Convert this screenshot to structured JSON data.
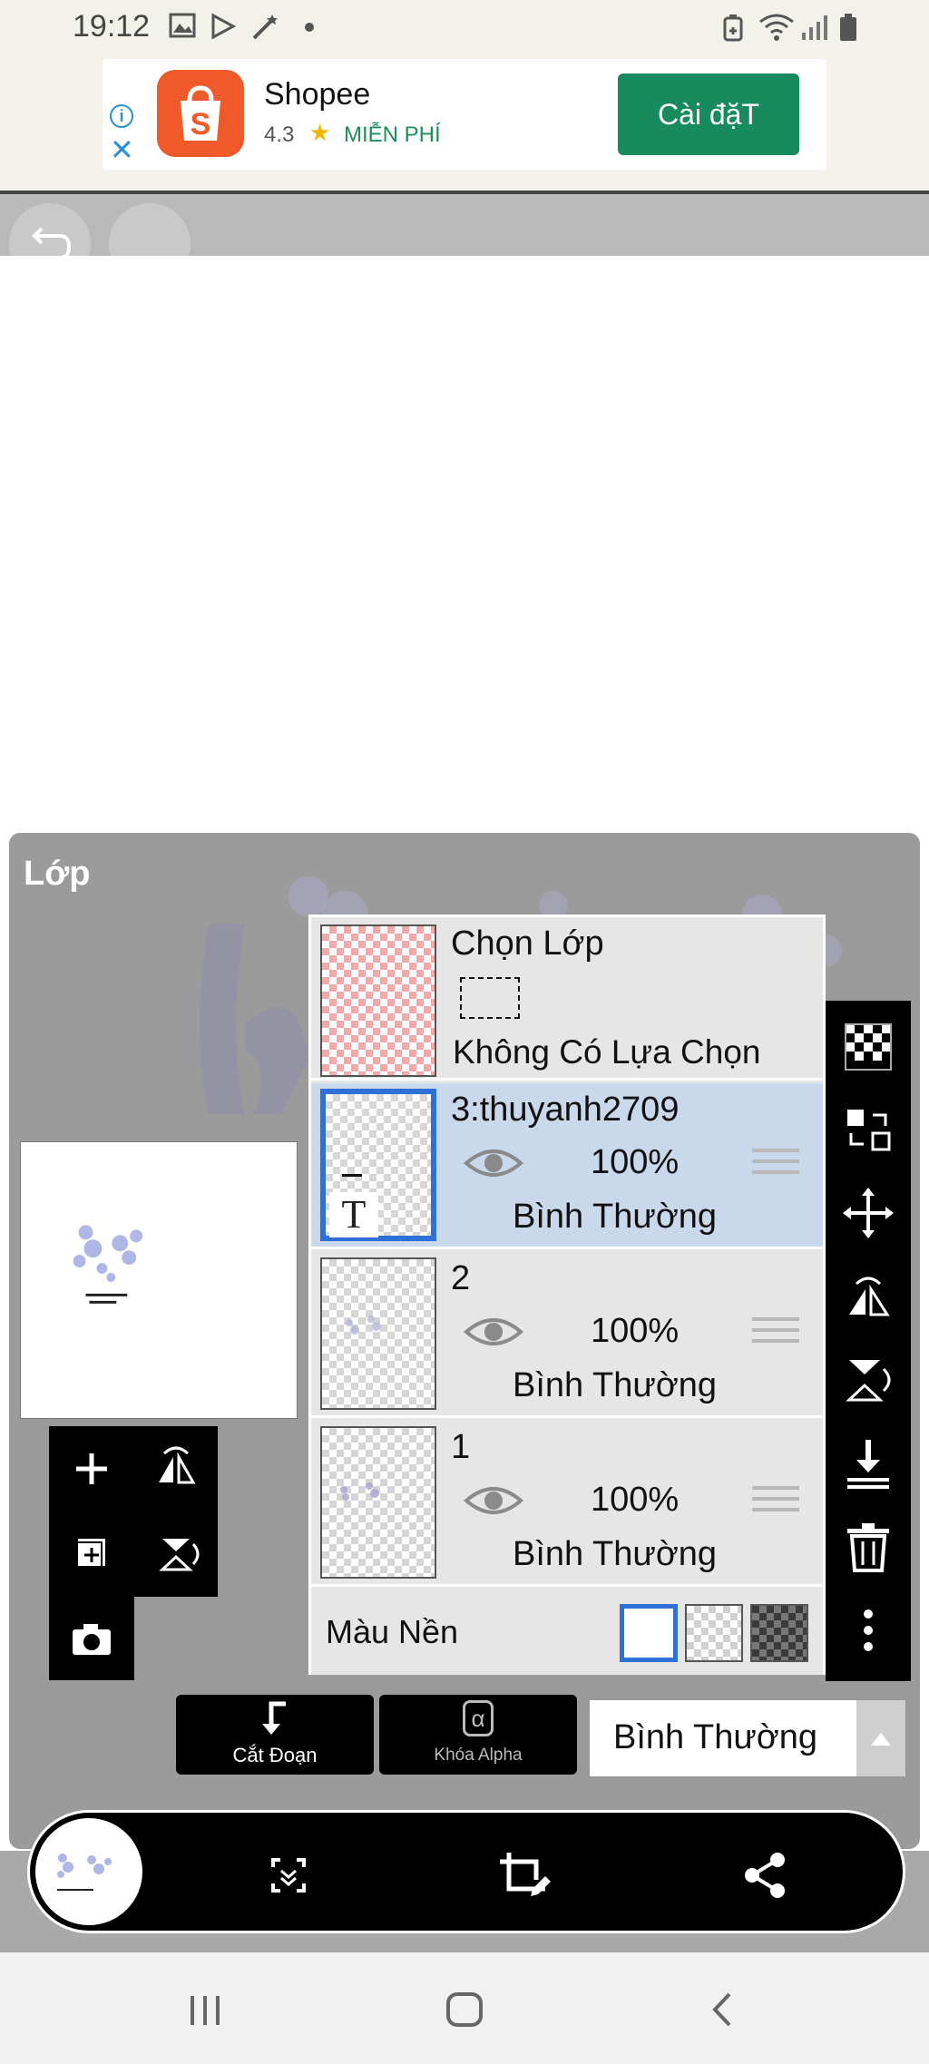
{
  "status_bar": {
    "time": "19:12",
    "left_icons": [
      "gallery-icon",
      "play-store-icon",
      "magic-wand-icon",
      "dot-icon"
    ],
    "right_icons": [
      "battery-saver-icon",
      "wifi-icon",
      "signal-icon",
      "battery-icon"
    ]
  },
  "ad": {
    "app_name": "Shopee",
    "rating": "4.3",
    "price": "MIỄN PHÍ",
    "install_label": "Cài đặT"
  },
  "layer_panel": {
    "title": "Lớp",
    "selection_row": {
      "title": "Chọn Lớp",
      "status": "Không Có Lựa Chọn"
    },
    "layers": [
      {
        "name": "3:thuyanh2709",
        "opacity": "100%",
        "blend": "Bình Thường",
        "selected": true,
        "kind": "text",
        "type_glyph": "T"
      },
      {
        "name": "2",
        "opacity": "100%",
        "blend": "Bình Thường",
        "selected": false,
        "kind": "image"
      },
      {
        "name": "1",
        "opacity": "100%",
        "blend": "Bình Thường",
        "selected": false,
        "kind": "image"
      }
    ],
    "background": {
      "label": "Màu Nền",
      "options": [
        "white",
        "transparent",
        "dark-checker"
      ],
      "selected": "white"
    },
    "bottom": {
      "clip_label": "Cắt Đoạn",
      "alpha_lock_label": "Khóa Alpha",
      "alpha_glyph": "α",
      "blend_mode": "Bình Thường"
    }
  },
  "colors": {
    "accent_blue": "#2f6fd8",
    "install_green": "#178b5d",
    "shopee_orange": "#f05a2a",
    "selected_row": "#cad8ec"
  }
}
